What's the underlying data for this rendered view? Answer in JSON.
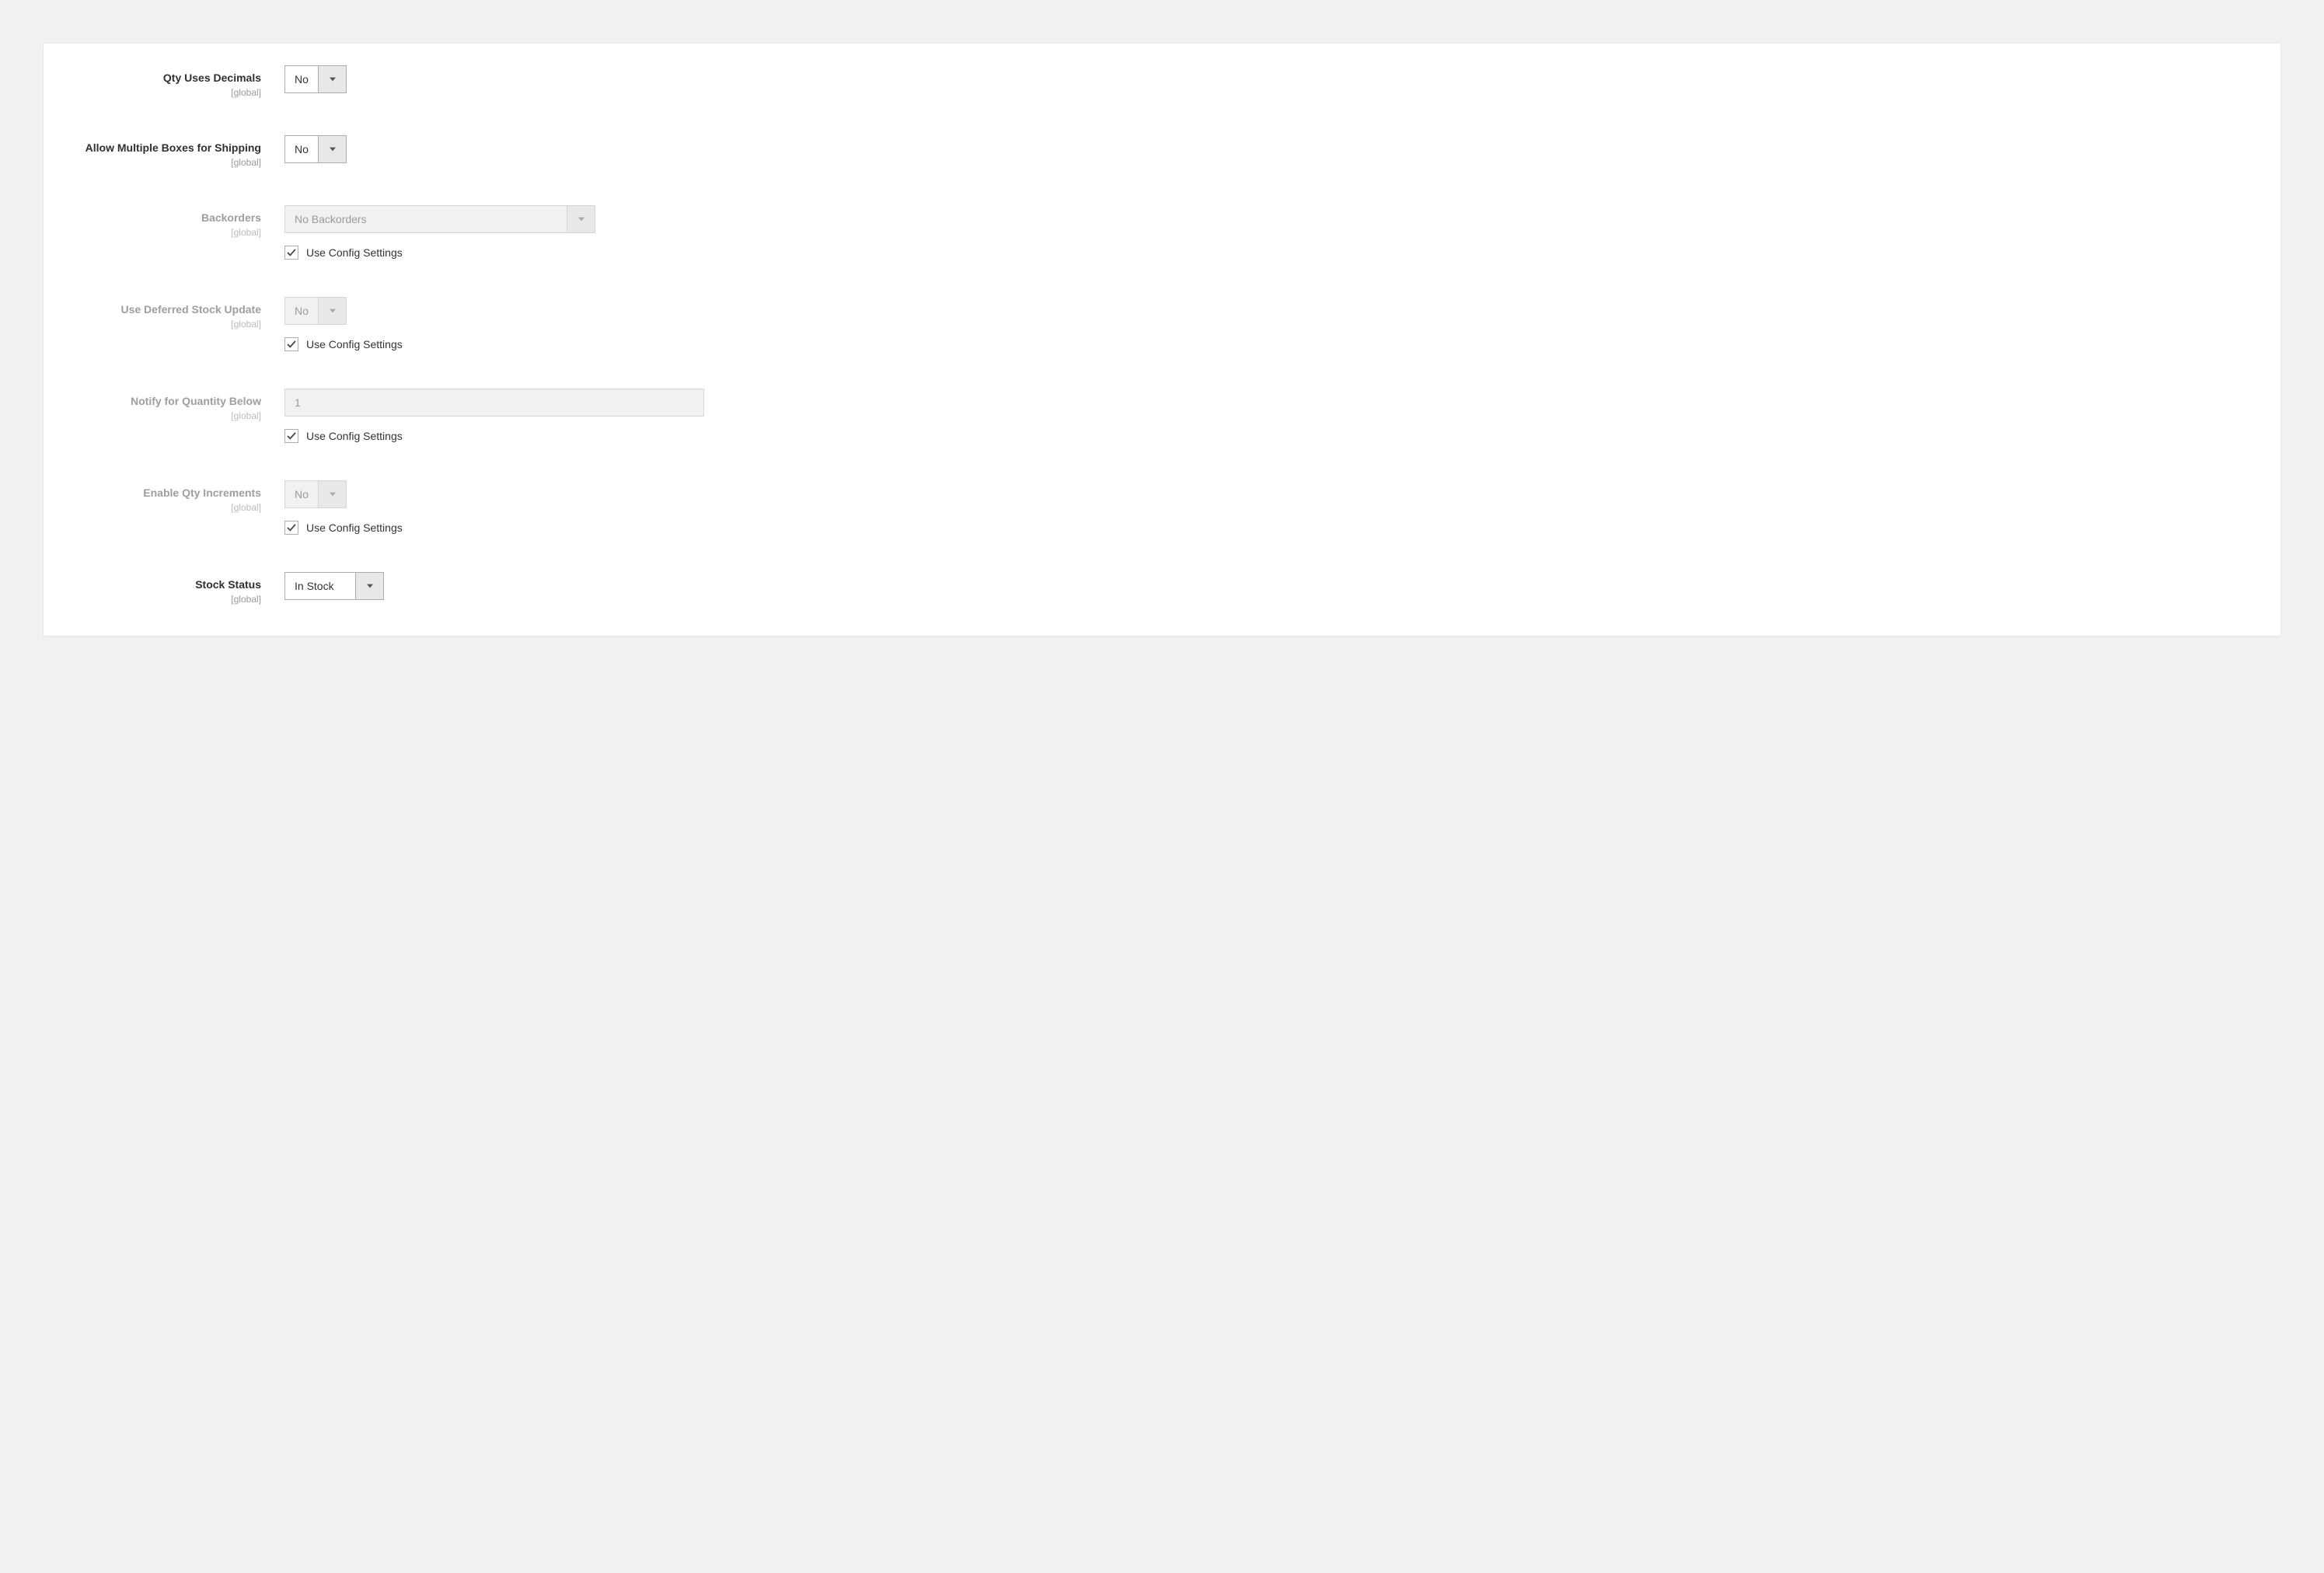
{
  "scope_label": "[global]",
  "use_config_label": "Use Config Settings",
  "fields": {
    "qty_uses_decimals": {
      "label": "Qty Uses Decimals",
      "value": "No",
      "disabled": false
    },
    "allow_multiple_boxes": {
      "label": "Allow Multiple Boxes for Shipping",
      "value": "No",
      "disabled": false
    },
    "backorders": {
      "label": "Backorders",
      "value": "No Backorders",
      "disabled": true,
      "use_config": true
    },
    "deferred_stock_update": {
      "label": "Use Deferred Stock Update",
      "value": "No",
      "disabled": true,
      "use_config": true
    },
    "notify_qty_below": {
      "label": "Notify for Quantity Below",
      "value": "1",
      "disabled": true,
      "use_config": true
    },
    "enable_qty_increments": {
      "label": "Enable Qty Increments",
      "value": "No",
      "disabled": true,
      "use_config": true
    },
    "stock_status": {
      "label": "Stock Status",
      "value": "In Stock",
      "disabled": false
    }
  }
}
